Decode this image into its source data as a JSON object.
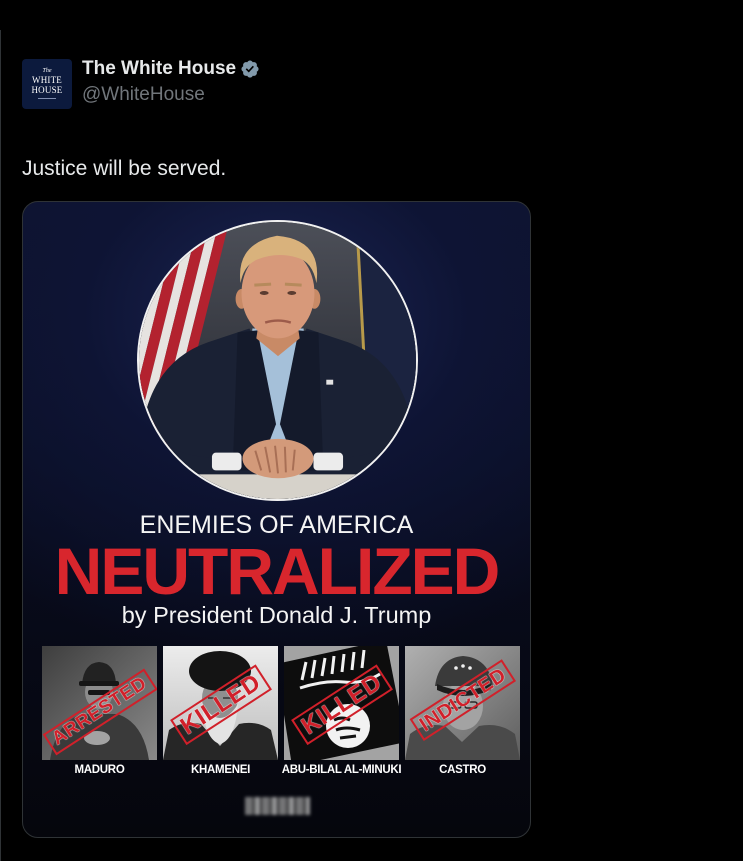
{
  "tweet": {
    "author": {
      "name": "The White House",
      "handle": "@WhiteHouse",
      "verified": true,
      "badge_icon": "verified-badge-icon",
      "avatar_logo": [
        "The",
        "WHITE",
        "HOUSE"
      ]
    },
    "text": "Justice will be served."
  },
  "media": {
    "kicker": "ENEMIES OF AMERICA",
    "headline": "NEUTRALIZED",
    "byline": "by President Donald J. Trump",
    "enemies": [
      {
        "name": "MADURO",
        "status": "ARRESTED"
      },
      {
        "name": "KHAMENEI",
        "status": "KILLED"
      },
      {
        "name": "ABU-BILAL AL-MINUKI",
        "status": "KILLED"
      },
      {
        "name": "CASTRO",
        "status": "INDICTED"
      }
    ]
  },
  "colors": {
    "background": "#000000",
    "text_primary": "#e7e9ea",
    "text_secondary": "#71767b",
    "border": "#2f3336",
    "verified_badge": "#829aab",
    "headline_red": "#d8262d",
    "stamp_red": "#d1202a"
  }
}
